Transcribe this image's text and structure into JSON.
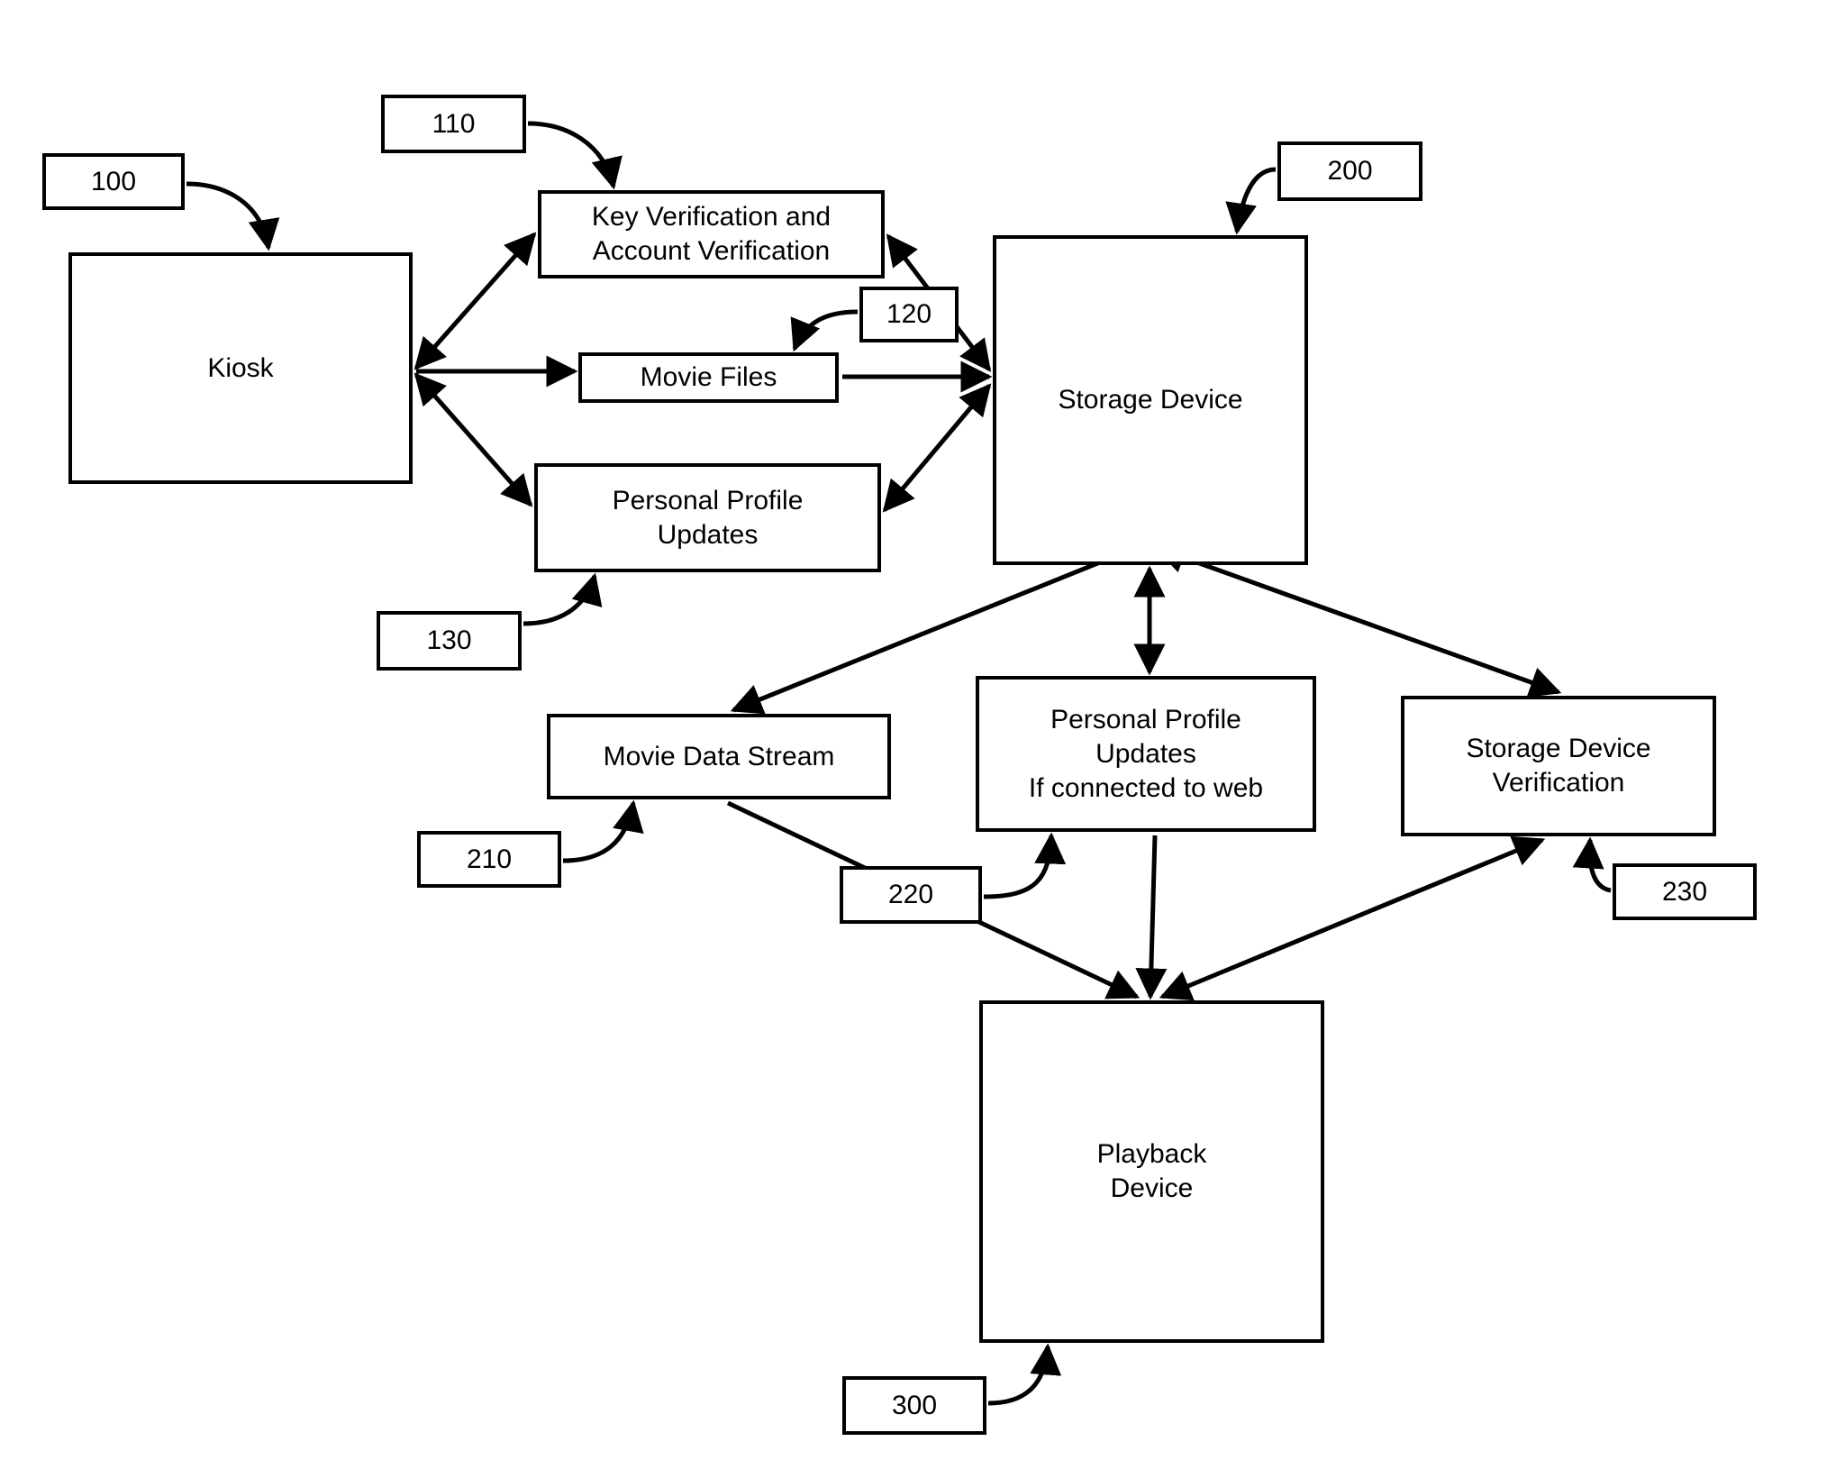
{
  "diagram": {
    "nodes": {
      "kiosk": {
        "label": "Kiosk",
        "ref": "100"
      },
      "key_verification": {
        "label": "Key Verification and\nAccount Verification",
        "ref": "110"
      },
      "movie_files": {
        "label": "Movie Files",
        "ref": "120"
      },
      "profile_updates_kiosk": {
        "label": "Personal Profile\nUpdates",
        "ref": "130"
      },
      "storage_device": {
        "label": "Storage Device",
        "ref": "200"
      },
      "movie_data_stream": {
        "label": "Movie Data Stream",
        "ref": "210"
      },
      "profile_updates_web": {
        "label": "Personal Profile\nUpdates\nIf connected to web",
        "ref": "220"
      },
      "storage_verification": {
        "label": "Storage Device\nVerification",
        "ref": "230"
      },
      "playback_device": {
        "label": "Playback\nDevice",
        "ref": "300"
      }
    },
    "edges": [
      {
        "from": "kiosk",
        "to": "key_verification",
        "direction": "both"
      },
      {
        "from": "kiosk",
        "to": "movie_files",
        "direction": "forward"
      },
      {
        "from": "kiosk",
        "to": "profile_updates_kiosk",
        "direction": "both"
      },
      {
        "from": "key_verification",
        "to": "storage_device",
        "direction": "both"
      },
      {
        "from": "movie_files",
        "to": "storage_device",
        "direction": "forward"
      },
      {
        "from": "profile_updates_kiosk",
        "to": "storage_device",
        "direction": "both"
      },
      {
        "from": "storage_device",
        "to": "movie_data_stream",
        "direction": "forward"
      },
      {
        "from": "storage_device",
        "to": "profile_updates_web",
        "direction": "both"
      },
      {
        "from": "storage_device",
        "to": "storage_verification",
        "direction": "both"
      },
      {
        "from": "movie_data_stream",
        "to": "playback_device",
        "direction": "forward"
      },
      {
        "from": "profile_updates_web",
        "to": "playback_device",
        "direction": "forward"
      },
      {
        "from": "storage_verification",
        "to": "playback_device",
        "direction": "both"
      }
    ]
  }
}
